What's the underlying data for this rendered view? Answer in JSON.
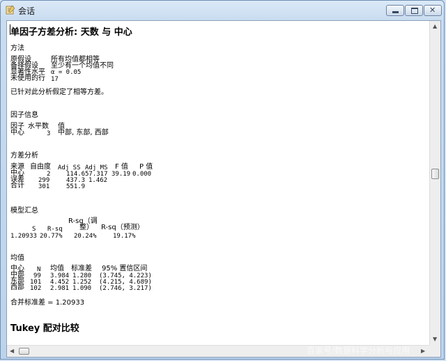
{
  "window": {
    "title": "会话"
  },
  "report": {
    "heading": "单因子方差分析: 天数 与 中心",
    "method": {
      "title": "方法",
      "rows": [
        {
          "label": "原假设",
          "value": "所有均值都相等"
        },
        {
          "label": "备择假设",
          "value": "至少有一个均值不同"
        },
        {
          "label": "显著性水平",
          "value": "α = 0.05"
        },
        {
          "label": "未使用的行",
          "value": "17"
        }
      ],
      "note": "已针对此分析假定了相等方差。"
    },
    "factor_info": {
      "title": "因子信息",
      "headers": [
        "因子",
        "水平数",
        "值"
      ],
      "row": [
        "中心",
        "3",
        "中部, 东部, 西部"
      ]
    },
    "anova": {
      "title": "方差分析",
      "headers": [
        "来源",
        "自由度",
        "Adj SS",
        "Adj MS",
        "F 值",
        "P 值"
      ],
      "rows": [
        [
          "中心",
          "2",
          "114.6",
          "57.317",
          "39.19",
          "0.000"
        ],
        [
          "误差",
          "299",
          "437.3",
          "1.462",
          "",
          ""
        ],
        [
          "合计",
          "301",
          "551.9",
          "",
          "",
          ""
        ]
      ]
    },
    "model_summary": {
      "title": "模型汇总",
      "headers": [
        "S",
        "R-sq",
        "R-sq（调整）",
        "R-sq（预测）"
      ],
      "header_line1": "R-sq（调",
      "header_line2a": "整）",
      "header_pred": "R-sq（预测）",
      "row": [
        "1.20933",
        "20.77%",
        "20.24%",
        "19.17%"
      ]
    },
    "means": {
      "title": "均值",
      "headers": [
        "中心",
        "N",
        "均值",
        "标准差",
        "95% 置信区间"
      ],
      "rows": [
        [
          "中部",
          "99",
          "3.984",
          "1.280",
          "(3.745, 4.223)"
        ],
        [
          "东部",
          "101",
          "4.452",
          "1.252",
          "(4.215, 4.689)"
        ],
        [
          "西部",
          "102",
          "2.981",
          "1.090",
          "(2.746, 3.217)"
        ]
      ],
      "pooled": "合并标准差 = 1.20933"
    },
    "tukey_title": "Tukey 配对比较"
  },
  "watermark": "百家号/数据科学分析与应用"
}
